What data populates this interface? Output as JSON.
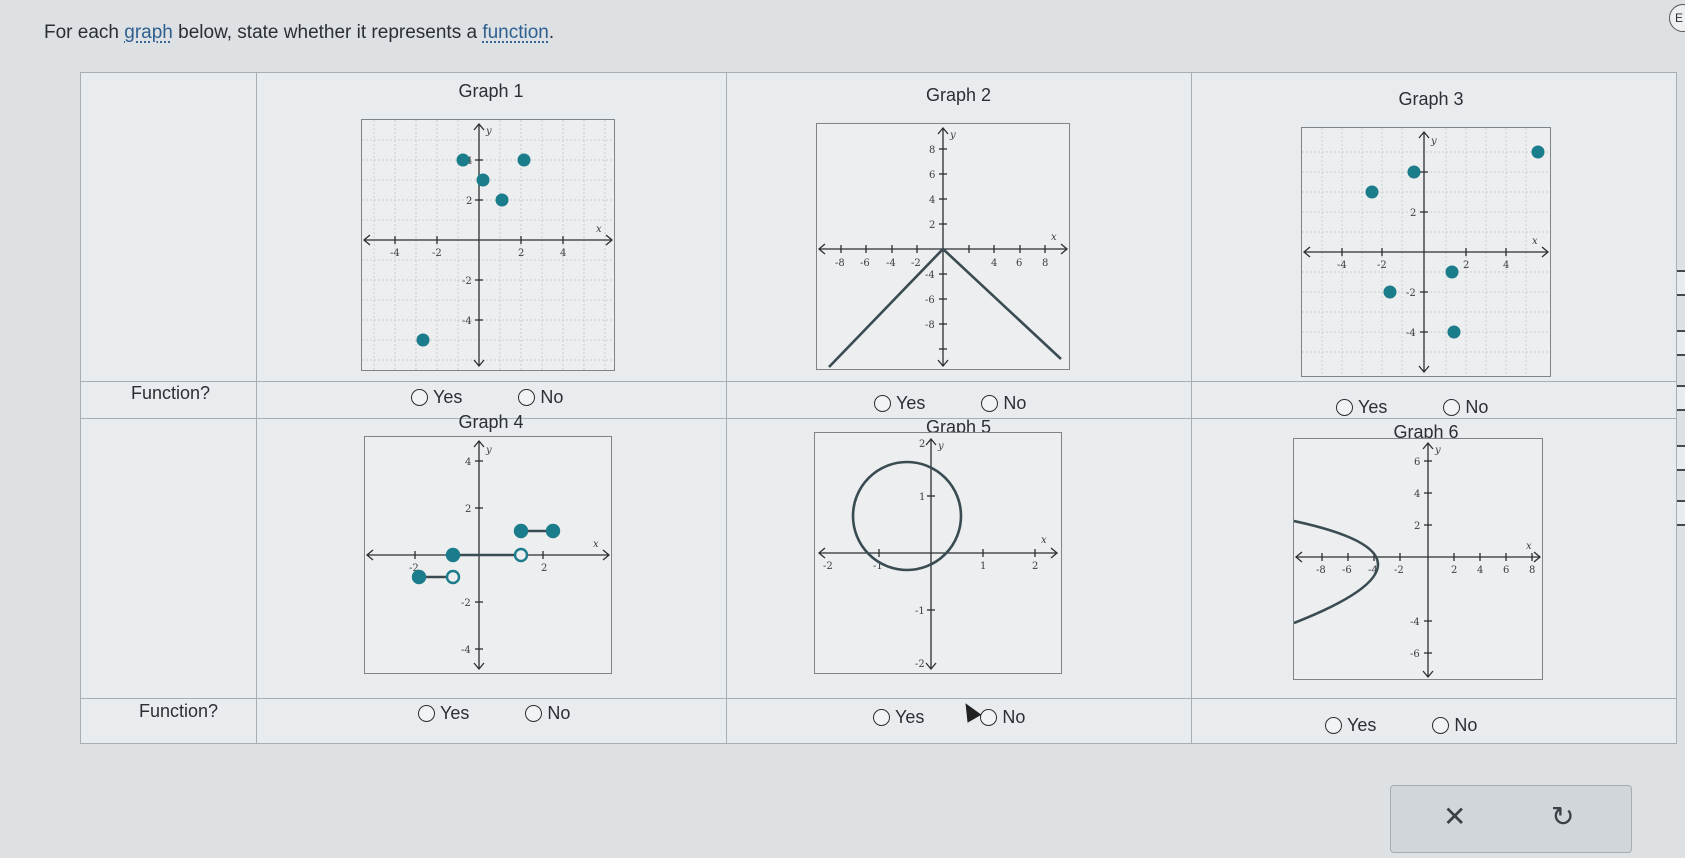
{
  "prompt": {
    "before": "For each ",
    "term1": "graph",
    "middle": " below, state whether it represents a ",
    "term2": "function",
    "after": "."
  },
  "corner_button": "E",
  "row_label": "Function?",
  "option_yes": "Yes",
  "option_no": "No",
  "graphs": [
    {
      "title": "Graph 1",
      "xticks": [
        "-4",
        "-2",
        "2",
        "4"
      ],
      "yticks": [
        "4",
        "2",
        "-2",
        "-4"
      ],
      "axis_x": "x",
      "axis_y": "y"
    },
    {
      "title": "Graph 2",
      "xticks": [
        "-8",
        "-6",
        "-4",
        "-2",
        "4",
        "6",
        "8"
      ],
      "yticks": [
        "8",
        "6",
        "4",
        "2",
        "-4",
        "-6",
        "-8"
      ],
      "axis_x": "x",
      "axis_y": "y"
    },
    {
      "title": "Graph 3",
      "xticks": [
        "-4",
        "-2",
        "2",
        "4"
      ],
      "yticks": [
        "4",
        "2",
        "-2",
        "-4"
      ],
      "axis_x": "x",
      "axis_y": "y"
    },
    {
      "title": "Graph 4",
      "xticks": [
        "-2",
        "2"
      ],
      "yticks": [
        "4",
        "2",
        "-2",
        "-4"
      ],
      "axis_x": "x",
      "axis_y": "y"
    },
    {
      "title": "Graph 5",
      "xticks": [
        "-2",
        "-1",
        "1",
        "2"
      ],
      "yticks": [
        "2",
        "1",
        "-1",
        "-2"
      ],
      "axis_x": "x",
      "axis_y": "y"
    },
    {
      "title": "Graph 6",
      "xticks": [
        "-8",
        "-6",
        "-4",
        "-2",
        "2",
        "4",
        "6",
        "8"
      ],
      "yticks": [
        "6",
        "4",
        "2",
        "-4",
        "-6"
      ],
      "axis_x": "x",
      "axis_y": "y"
    }
  ],
  "actions": {
    "clear": "✕",
    "undo": "↻"
  },
  "colors": {
    "point": "#1b7c8c",
    "line": "#3a4b52",
    "background": "#dde1e4"
  }
}
